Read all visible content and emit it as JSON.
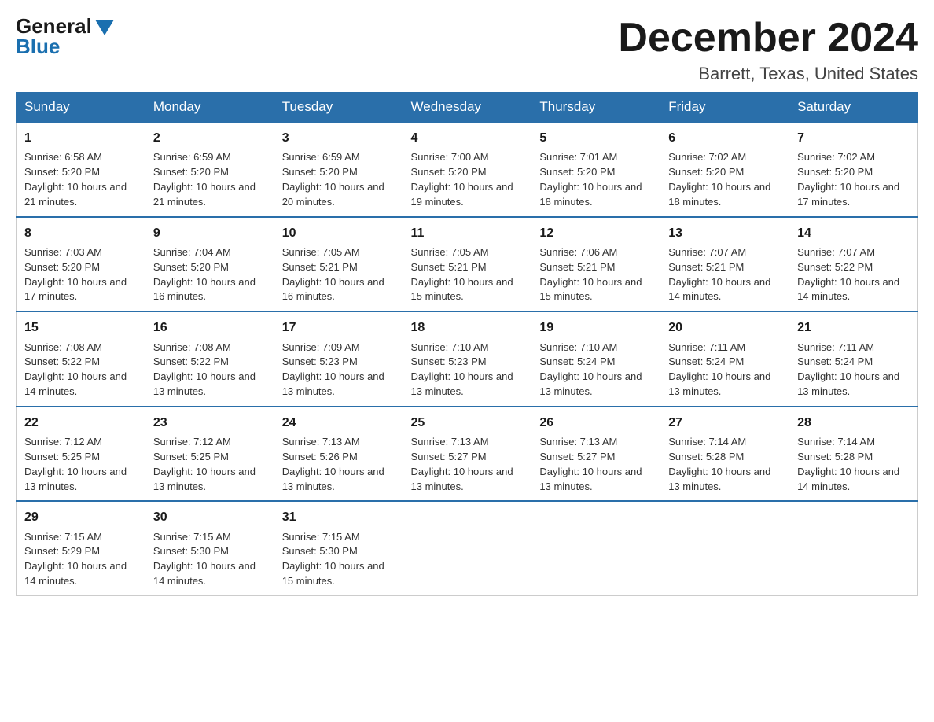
{
  "logo": {
    "general": "General",
    "blue": "Blue"
  },
  "title": "December 2024",
  "subtitle": "Barrett, Texas, United States",
  "days_of_week": [
    "Sunday",
    "Monday",
    "Tuesday",
    "Wednesday",
    "Thursday",
    "Friday",
    "Saturday"
  ],
  "weeks": [
    [
      {
        "day": "1",
        "sunrise": "6:58 AM",
        "sunset": "5:20 PM",
        "daylight": "10 hours and 21 minutes."
      },
      {
        "day": "2",
        "sunrise": "6:59 AM",
        "sunset": "5:20 PM",
        "daylight": "10 hours and 21 minutes."
      },
      {
        "day": "3",
        "sunrise": "6:59 AM",
        "sunset": "5:20 PM",
        "daylight": "10 hours and 20 minutes."
      },
      {
        "day": "4",
        "sunrise": "7:00 AM",
        "sunset": "5:20 PM",
        "daylight": "10 hours and 19 minutes."
      },
      {
        "day": "5",
        "sunrise": "7:01 AM",
        "sunset": "5:20 PM",
        "daylight": "10 hours and 18 minutes."
      },
      {
        "day": "6",
        "sunrise": "7:02 AM",
        "sunset": "5:20 PM",
        "daylight": "10 hours and 18 minutes."
      },
      {
        "day": "7",
        "sunrise": "7:02 AM",
        "sunset": "5:20 PM",
        "daylight": "10 hours and 17 minutes."
      }
    ],
    [
      {
        "day": "8",
        "sunrise": "7:03 AM",
        "sunset": "5:20 PM",
        "daylight": "10 hours and 17 minutes."
      },
      {
        "day": "9",
        "sunrise": "7:04 AM",
        "sunset": "5:20 PM",
        "daylight": "10 hours and 16 minutes."
      },
      {
        "day": "10",
        "sunrise": "7:05 AM",
        "sunset": "5:21 PM",
        "daylight": "10 hours and 16 minutes."
      },
      {
        "day": "11",
        "sunrise": "7:05 AM",
        "sunset": "5:21 PM",
        "daylight": "10 hours and 15 minutes."
      },
      {
        "day": "12",
        "sunrise": "7:06 AM",
        "sunset": "5:21 PM",
        "daylight": "10 hours and 15 minutes."
      },
      {
        "day": "13",
        "sunrise": "7:07 AM",
        "sunset": "5:21 PM",
        "daylight": "10 hours and 14 minutes."
      },
      {
        "day": "14",
        "sunrise": "7:07 AM",
        "sunset": "5:22 PM",
        "daylight": "10 hours and 14 minutes."
      }
    ],
    [
      {
        "day": "15",
        "sunrise": "7:08 AM",
        "sunset": "5:22 PM",
        "daylight": "10 hours and 14 minutes."
      },
      {
        "day": "16",
        "sunrise": "7:08 AM",
        "sunset": "5:22 PM",
        "daylight": "10 hours and 13 minutes."
      },
      {
        "day": "17",
        "sunrise": "7:09 AM",
        "sunset": "5:23 PM",
        "daylight": "10 hours and 13 minutes."
      },
      {
        "day": "18",
        "sunrise": "7:10 AM",
        "sunset": "5:23 PM",
        "daylight": "10 hours and 13 minutes."
      },
      {
        "day": "19",
        "sunrise": "7:10 AM",
        "sunset": "5:24 PM",
        "daylight": "10 hours and 13 minutes."
      },
      {
        "day": "20",
        "sunrise": "7:11 AM",
        "sunset": "5:24 PM",
        "daylight": "10 hours and 13 minutes."
      },
      {
        "day": "21",
        "sunrise": "7:11 AM",
        "sunset": "5:24 PM",
        "daylight": "10 hours and 13 minutes."
      }
    ],
    [
      {
        "day": "22",
        "sunrise": "7:12 AM",
        "sunset": "5:25 PM",
        "daylight": "10 hours and 13 minutes."
      },
      {
        "day": "23",
        "sunrise": "7:12 AM",
        "sunset": "5:25 PM",
        "daylight": "10 hours and 13 minutes."
      },
      {
        "day": "24",
        "sunrise": "7:13 AM",
        "sunset": "5:26 PM",
        "daylight": "10 hours and 13 minutes."
      },
      {
        "day": "25",
        "sunrise": "7:13 AM",
        "sunset": "5:27 PM",
        "daylight": "10 hours and 13 minutes."
      },
      {
        "day": "26",
        "sunrise": "7:13 AM",
        "sunset": "5:27 PM",
        "daylight": "10 hours and 13 minutes."
      },
      {
        "day": "27",
        "sunrise": "7:14 AM",
        "sunset": "5:28 PM",
        "daylight": "10 hours and 13 minutes."
      },
      {
        "day": "28",
        "sunrise": "7:14 AM",
        "sunset": "5:28 PM",
        "daylight": "10 hours and 14 minutes."
      }
    ],
    [
      {
        "day": "29",
        "sunrise": "7:15 AM",
        "sunset": "5:29 PM",
        "daylight": "10 hours and 14 minutes."
      },
      {
        "day": "30",
        "sunrise": "7:15 AM",
        "sunset": "5:30 PM",
        "daylight": "10 hours and 14 minutes."
      },
      {
        "day": "31",
        "sunrise": "7:15 AM",
        "sunset": "5:30 PM",
        "daylight": "10 hours and 15 minutes."
      },
      null,
      null,
      null,
      null
    ]
  ]
}
